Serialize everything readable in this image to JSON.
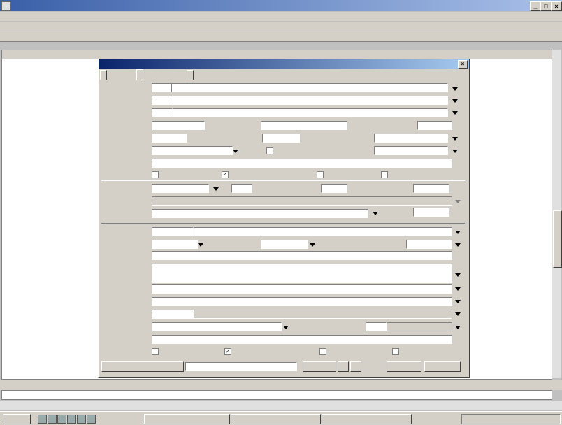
{
  "window": {
    "title": "",
    "min": "_",
    "max": "□",
    "close": "×"
  },
  "menubar": [],
  "toolbar": [],
  "subtoolbar": {
    "label": ""
  },
  "grid": {
    "headers": [],
    "rows": []
  },
  "dialog": {
    "title": "",
    "close": "×",
    "tabs": [],
    "fields": {},
    "checks_row1": [],
    "checks_row2": [],
    "checks_row3": [],
    "buttons": {}
  },
  "bottom": {
    "label": "",
    "input": ""
  },
  "taskbar": {
    "start": "",
    "tasks": []
  }
}
